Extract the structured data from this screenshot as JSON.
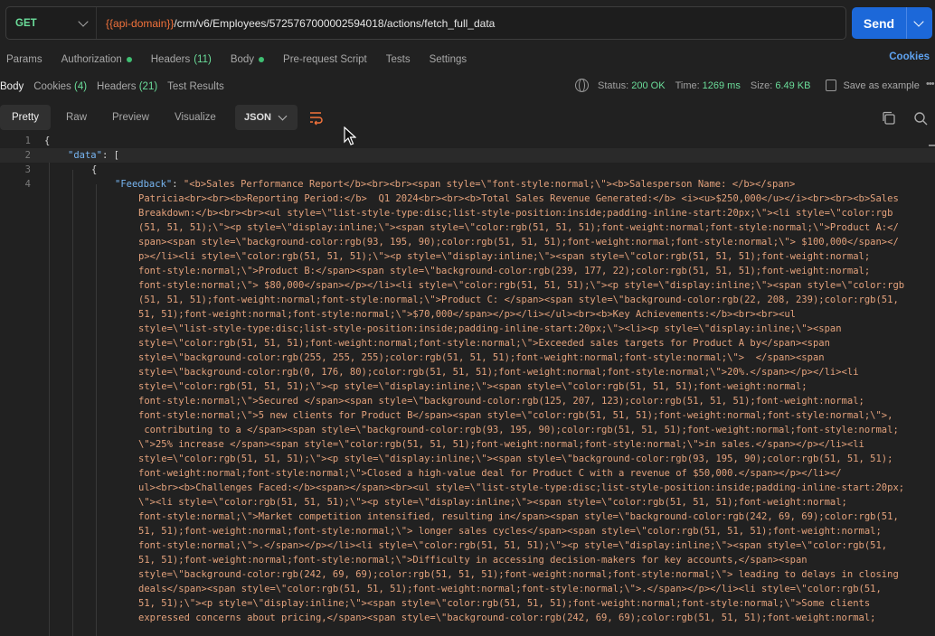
{
  "request": {
    "method": "GET",
    "url_variable": "{{api-domain}}",
    "url_path": "/crm/v6/Employees/5725767000002594018/actions/fetch_full_data",
    "send_label": "Send"
  },
  "request_tabs": [
    {
      "label": "Params",
      "count": "",
      "dot": false
    },
    {
      "label": "Authorization",
      "count": "",
      "dot": true
    },
    {
      "label": "Headers",
      "count": "(11)",
      "dot": false
    },
    {
      "label": "Body",
      "count": "",
      "dot": true
    },
    {
      "label": "Pre-request Script",
      "count": "",
      "dot": false
    },
    {
      "label": "Tests",
      "count": "",
      "dot": false
    },
    {
      "label": "Settings",
      "count": "",
      "dot": false
    }
  ],
  "cookies_link": "Cookies",
  "response_tabs": [
    {
      "label": "Body",
      "count": ""
    },
    {
      "label": "Cookies",
      "count": "(4)"
    },
    {
      "label": "Headers",
      "count": "(21)"
    },
    {
      "label": "Test Results",
      "count": ""
    }
  ],
  "response_status": {
    "status_label": "Status:",
    "status_value": "200 OK",
    "time_label": "Time:",
    "time_value": "1269 ms",
    "size_label": "Size:",
    "size_value": "6.49 KB",
    "save_label": "Save as example"
  },
  "view_modes": [
    "Pretty",
    "Raw",
    "Preview",
    "Visualize"
  ],
  "format": "JSON",
  "colors": {
    "accent": "#1c68d9",
    "success": "#6bdd9a",
    "variable": "#f2723b",
    "string": "#e4a27c",
    "key": "#78b6f2"
  },
  "code": {
    "line_numbers": [
      "1",
      "2",
      "3",
      "4"
    ],
    "line1": "{",
    "line2_key": "\"data\"",
    "line2_rest": ": [",
    "line3": "{",
    "line4_key": "\"Feedback\"",
    "line4_colon": ": ",
    "feedback_lines": [
      "\"<b>Sales Performance Report</b><br><br><span style=\\\"font-style:normal;\\\"><b>Salesperson Name: </b></span>",
      "Patricia<br><br><b>Reporting Period:</b>  Q1 2024<br><br><b>Total Sales Revenue Generated:</b> <i><u>$250,000</u></i><br><br><b>Sales",
      "Breakdown:</b><br><br><ul style=\\\"list-style-type:disc;list-style-position:inside;padding-inline-start:20px;\\\"><li style=\\\"color:rgb",
      "(51, 51, 51);\\\"><p style=\\\"display:inline;\\\"><span style=\\\"color:rgb(51, 51, 51);font-weight:normal;font-style:normal;\\\">Product A:</",
      "span><span style=\\\"background-color:rgb(93, 195, 90);color:rgb(51, 51, 51);font-weight:normal;font-style:normal;\\\"> $100,000</span></",
      "p></li><li style=\\\"color:rgb(51, 51, 51);\\\"><p style=\\\"display:inline;\\\"><span style=\\\"color:rgb(51, 51, 51);font-weight:normal;",
      "font-style:normal;\\\">Product B:</span><span style=\\\"background-color:rgb(239, 177, 22);color:rgb(51, 51, 51);font-weight:normal;",
      "font-style:normal;\\\"> $80,000</span></p></li><li style=\\\"color:rgb(51, 51, 51);\\\"><p style=\\\"display:inline;\\\"><span style=\\\"color:rgb",
      "(51, 51, 51);font-weight:normal;font-style:normal;\\\">Product C: </span><span style=\\\"background-color:rgb(22, 208, 239);color:rgb(51,",
      "51, 51);font-weight:normal;font-style:normal;\\\">$70,000</span></p></li></ul><br><b>Key Achievements:</b><br><br><ul",
      "style=\\\"list-style-type:disc;list-style-position:inside;padding-inline-start:20px;\\\"><li><p style=\\\"display:inline;\\\"><span",
      "style=\\\"color:rgb(51, 51, 51);font-weight:normal;font-style:normal;\\\">Exceeded sales targets for Product A by</span><span",
      "style=\\\"background-color:rgb(255, 255, 255);color:rgb(51, 51, 51);font-weight:normal;font-style:normal;\\\">  </span><span",
      "style=\\\"background-color:rgb(0, 176, 80);color:rgb(51, 51, 51);font-weight:normal;font-style:normal;\\\">20%.</span></p></li><li",
      "style=\\\"color:rgb(51, 51, 51);\\\"><p style=\\\"display:inline;\\\"><span style=\\\"color:rgb(51, 51, 51);font-weight:normal;",
      "font-style:normal;\\\">Secured </span><span style=\\\"background-color:rgb(125, 207, 123);color:rgb(51, 51, 51);font-weight:normal;",
      "font-style:normal;\\\">5 new clients for Product B</span><span style=\\\"color:rgb(51, 51, 51);font-weight:normal;font-style:normal;\\\">,",
      " contributing to a </span><span style=\\\"background-color:rgb(93, 195, 90);color:rgb(51, 51, 51);font-weight:normal;font-style:normal;",
      "\\\">25% increase </span><span style=\\\"color:rgb(51, 51, 51);font-weight:normal;font-style:normal;\\\">in sales.</span></p></li><li",
      "style=\\\"color:rgb(51, 51, 51);\\\"><p style=\\\"display:inline;\\\"><span style=\\\"background-color:rgb(93, 195, 90);color:rgb(51, 51, 51);",
      "font-weight:normal;font-style:normal;\\\">Closed a high-value deal for Product C with a revenue of $50,000.</span></p></li></",
      "ul><br><b>Challenges Faced:</b><span></span><br><ul style=\\\"list-style-type:disc;list-style-position:inside;padding-inline-start:20px;",
      "\\\"><li style=\\\"color:rgb(51, 51, 51);\\\"><p style=\\\"display:inline;\\\"><span style=\\\"color:rgb(51, 51, 51);font-weight:normal;",
      "font-style:normal;\\\">Market competition intensified, resulting in</span><span style=\\\"background-color:rgb(242, 69, 69);color:rgb(51,",
      "51, 51);font-weight:normal;font-style:normal;\\\"> longer sales cycles</span><span style=\\\"color:rgb(51, 51, 51);font-weight:normal;",
      "font-style:normal;\\\">.</span></p></li><li style=\\\"color:rgb(51, 51, 51);\\\"><p style=\\\"display:inline;\\\"><span style=\\\"color:rgb(51,",
      "51, 51);font-weight:normal;font-style:normal;\\\">Difficulty in accessing decision-makers for key accounts,</span><span",
      "style=\\\"background-color:rgb(242, 69, 69);color:rgb(51, 51, 51);font-weight:normal;font-style:normal;\\\"> leading to delays in closing",
      "deals</span><span style=\\\"color:rgb(51, 51, 51);font-weight:normal;font-style:normal;\\\">.</span></p></li><li style=\\\"color:rgb(51,",
      "51, 51);\\\"><p style=\\\"display:inline;\\\"><span style=\\\"color:rgb(51, 51, 51);font-weight:normal;font-style:normal;\\\">Some clients",
      "expressed concerns about pricing,</span><span style=\\\"background-color:rgb(242, 69, 69);color:rgb(51, 51, 51);font-weight:normal;"
    ]
  }
}
